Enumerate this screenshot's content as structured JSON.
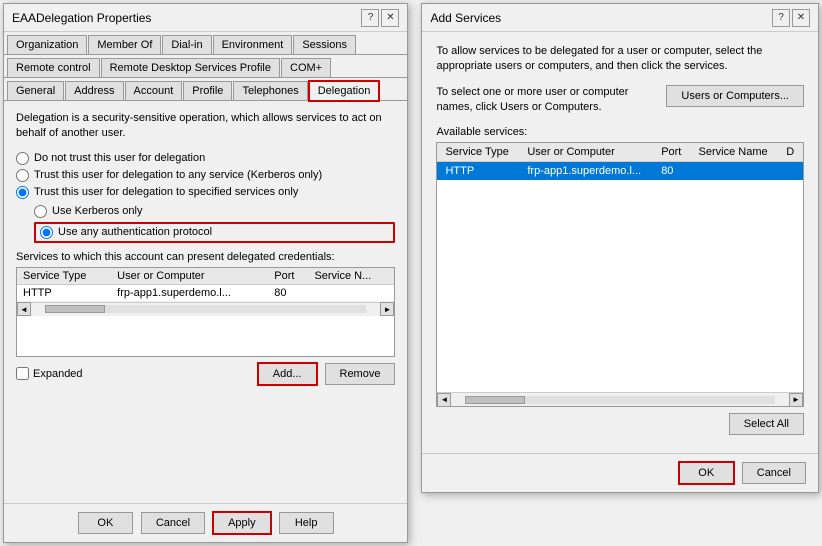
{
  "left_dialog": {
    "title": "EAADelegation Properties",
    "tabs_row1": [
      {
        "label": "Organization",
        "active": false
      },
      {
        "label": "Member Of",
        "active": false
      },
      {
        "label": "Dial-in",
        "active": false
      },
      {
        "label": "Environment",
        "active": false
      },
      {
        "label": "Sessions",
        "active": false
      }
    ],
    "tabs_row2": [
      {
        "label": "Remote control",
        "active": false
      },
      {
        "label": "Remote Desktop Services Profile",
        "active": false
      },
      {
        "label": "COM+",
        "active": false
      }
    ],
    "tabs_row3": [
      {
        "label": "General",
        "active": false
      },
      {
        "label": "Address",
        "active": false
      },
      {
        "label": "Account",
        "active": false
      },
      {
        "label": "Profile",
        "active": false
      },
      {
        "label": "Telephones",
        "active": false
      },
      {
        "label": "Delegation",
        "active": true,
        "highlighted": true
      }
    ],
    "description": "Delegation is a security-sensitive operation, which allows services to act on behalf of another user.",
    "radio_options": [
      {
        "id": "r1",
        "label": "Do not trust this user for delegation",
        "checked": false
      },
      {
        "id": "r2",
        "label": "Trust this user for delegation to any service (Kerberos only)",
        "checked": false
      },
      {
        "id": "r3",
        "label": "Trust this user for delegation to specified services only",
        "checked": true
      }
    ],
    "sub_radio_options": [
      {
        "id": "r4",
        "label": "Use Kerberos only",
        "checked": false
      },
      {
        "id": "r5",
        "label": "Use any authentication protocol",
        "checked": true,
        "highlighted": true
      }
    ],
    "services_label": "Services to which this account can present delegated credentials:",
    "table_headers": [
      "Service Type",
      "User or Computer",
      "Port",
      "Service N..."
    ],
    "table_rows": [
      {
        "service_type": "HTTP",
        "user_computer": "frp-app1.superdemo.l...",
        "port": "80",
        "service_name": ""
      }
    ],
    "expanded_label": "Expanded",
    "expanded_checked": false,
    "add_label": "Add...",
    "remove_label": "Remove",
    "footer_buttons": [
      "OK",
      "Cancel",
      "Apply",
      "Help"
    ],
    "apply_highlighted": true
  },
  "right_dialog": {
    "title": "Add Services",
    "description1": "To allow services to be delegated for a user or computer, select the appropriate users or computers, and then click the services.",
    "description2": "To select one or more user or computer names, click Users or Computers.",
    "users_computers_btn": "Users or Computers...",
    "available_label": "Available services:",
    "table_headers": [
      "Service Type",
      "User or Computer",
      "Port",
      "Service Name",
      "D"
    ],
    "table_rows": [
      {
        "service_type": "HTTP",
        "user_computer": "frp-app1.superdemo.l...",
        "port": "80",
        "service_name": "",
        "d": "",
        "selected": true
      }
    ],
    "select_all_label": "Select All",
    "footer_buttons": [
      "OK",
      "Cancel"
    ],
    "ok_highlighted": true
  },
  "icons": {
    "close": "✕",
    "minimize": "─",
    "help": "?",
    "arrow_left": "◄",
    "arrow_right": "►",
    "arrow_down": "▼"
  }
}
